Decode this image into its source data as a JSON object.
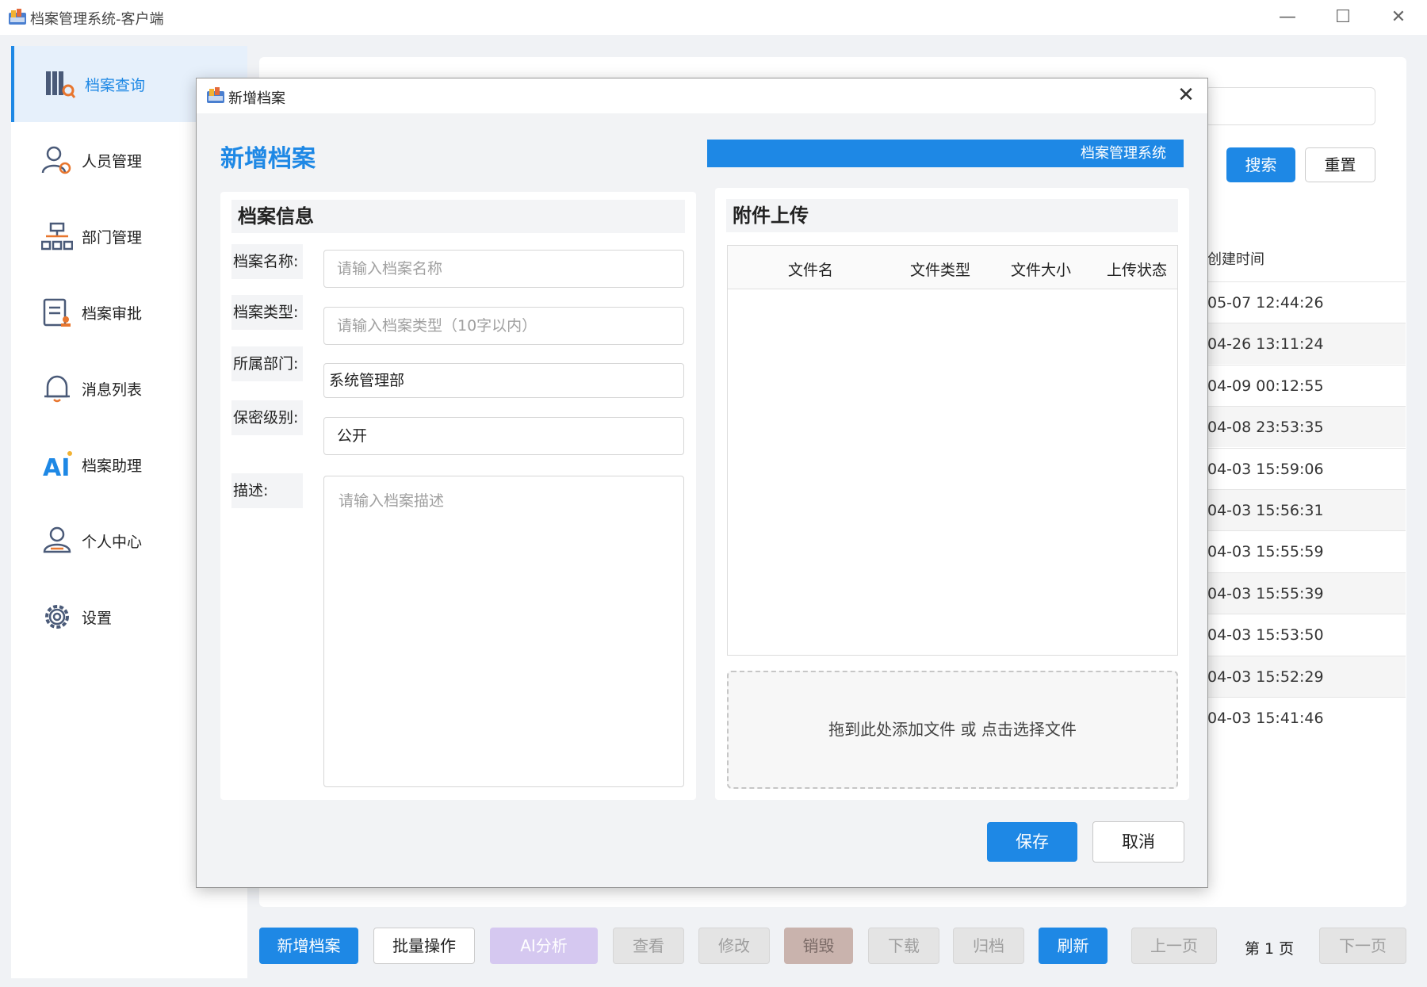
{
  "window": {
    "title": "档案管理系统-客户端",
    "controls": [
      "—",
      "☐",
      "✕"
    ]
  },
  "sidebar": {
    "items": [
      {
        "label": "档案查询",
        "icon": "archive-search-icon",
        "active": true
      },
      {
        "label": "人员管理",
        "icon": "user-settings-icon",
        "active": false
      },
      {
        "label": "部门管理",
        "icon": "org-chart-icon",
        "active": false
      },
      {
        "label": "档案审批",
        "icon": "approval-clipboard-icon",
        "active": false
      },
      {
        "label": "消息列表",
        "icon": "bell-icon",
        "active": false
      },
      {
        "label": "档案助理",
        "icon": "ai-icon",
        "active": false
      },
      {
        "label": "个人中心",
        "icon": "person-icon",
        "active": false
      },
      {
        "label": "设置",
        "icon": "gear-icon",
        "active": false
      }
    ]
  },
  "search": {
    "search_label": "搜索",
    "reset_label": "重置"
  },
  "background_table": {
    "created_header": "创建时间",
    "created_values": [
      "05-07 12:44:26",
      "04-26 13:11:24",
      "04-09 00:12:55",
      "04-08 23:53:35",
      "04-03 15:59:06",
      "04-03 15:56:31",
      "04-03 15:55:59",
      "04-03 15:55:39",
      "04-03 15:53:50",
      "04-03 15:52:29",
      "04-03 15:41:46"
    ]
  },
  "toolbar": {
    "new": "新增档案",
    "batch": "批量操作",
    "ai": "AI分析",
    "view": "查看",
    "edit": "修改",
    "destroy": "销毁",
    "download": "下载",
    "archive": "归档",
    "refresh": "刷新",
    "prev": "上一页",
    "page": "第 1 页",
    "next": "下一页"
  },
  "dialog": {
    "window_title": "新增档案",
    "heading": "新增档案",
    "brand": "档案管理系统",
    "info": {
      "title": "档案信息",
      "name_label": "档案名称:",
      "name_placeholder": "请输入档案名称",
      "type_label": "档案类型:",
      "type_placeholder": "请输入档案类型（10字以内）",
      "dept_label": "所属部门:",
      "dept_value": "系统管理部",
      "level_label": "保密级别:",
      "level_value": "公开",
      "desc_label": "描述:",
      "desc_placeholder": "请输入档案描述"
    },
    "attach": {
      "title": "附件上传",
      "columns": [
        "文件名",
        "文件类型",
        "文件大小",
        "上传状态"
      ],
      "dropzone": "拖到此处添加文件 或 点击选择文件"
    },
    "save": "保存",
    "cancel": "取消"
  }
}
